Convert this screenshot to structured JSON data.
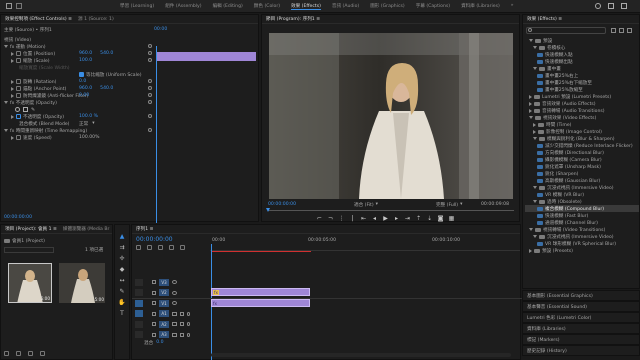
{
  "workspaces": [
    "學習 (Learning)",
    "組件 (Assembly)",
    "編輯 (Editing)",
    "顏色 (Color)",
    "效果 (Effects)",
    "音訊 (Audio)",
    "圖形 (Graphics)",
    "字幕 (Captions)",
    "資料庫 (Libraries)",
    "»"
  ],
  "active_workspace_index": 4,
  "effect_controls": {
    "tabs": [
      "效果控制項 (Effect Controls) ≡",
      "源 1 (Source: 1)"
    ],
    "source_label": "主要 (Source) • 序列1",
    "seq_label": "序列 (Sequence)",
    "ruler_time": "00:00",
    "video_label": "視訊 (Video)",
    "motion": "fx  運動 (Motion)",
    "position_label": "位置 (Position)",
    "position_x": "960.0",
    "position_y": "540.0",
    "scale_label": "縮放 (Scale)",
    "scale_value": "100.0",
    "scale_width_label": "縮放寬度 (Scale Width)",
    "uniform_scale": "等比縮放 (Uniform Scale)",
    "rotation_label": "旋轉 (Rotation)",
    "rotation_value": "0.0",
    "anchor_label": "錨點 (Anchor Point)",
    "anchor_x": "960.0",
    "anchor_y": "540.0",
    "flicker_label": "防閃爍濾鏡 (Anti-flicker Filter)",
    "flicker_value": "0.00",
    "opacity": "fx  不透明度 (Opacity)",
    "opacity_label": "不透明度 (Opacity)",
    "opacity_value": "100.0 %",
    "blend_label": "混合模式 (Blend Mode)",
    "blend_value": "正常",
    "time_remap": "fx  時間重新映射 (Time Remapping)",
    "speed_label": "速度 (Speed)",
    "speed_value": "100.00%",
    "time_display": "00:00:00:00"
  },
  "program": {
    "tab": "節目 (Program): 序列1 ≡",
    "timecode": "00:00:00:00",
    "fit": "適合 (Fit)",
    "full": "完整 (Full)",
    "duration": "00:00:09:08"
  },
  "effects": {
    "tab": "效果 (Effects) ≡",
    "items": [
      {
        "label": "預設",
        "indent": 1,
        "kind": "folder",
        "open": true
      },
      {
        "label": "卷積核心",
        "indent": 2,
        "kind": "folder",
        "open": true
      },
      {
        "label": "快速模糊入點",
        "indent": 3,
        "kind": "preset"
      },
      {
        "label": "快速模糊出點",
        "indent": 3,
        "kind": "preset"
      },
      {
        "label": "畫中畫",
        "indent": 2,
        "kind": "folder",
        "open": true
      },
      {
        "label": "畫中畫25%右上",
        "indent": 3,
        "kind": "preset"
      },
      {
        "label": "畫中畫25%右下縮放至",
        "indent": 3,
        "kind": "preset"
      },
      {
        "label": "畫中畫25%放縮至",
        "indent": 3,
        "kind": "preset"
      },
      {
        "label": "Lumetri 預設 (Lumetri Presets)",
        "indent": 1,
        "kind": "folder"
      },
      {
        "label": "音訊效果 (Audio Effects)",
        "indent": 1,
        "kind": "folder"
      },
      {
        "label": "音訊轉場 (Audio Transitions)",
        "indent": 1,
        "kind": "folder"
      },
      {
        "label": "視訊效果 (Video Effects)",
        "indent": 1,
        "kind": "folder",
        "open": true
      },
      {
        "label": "時間 (Time)",
        "indent": 2,
        "kind": "folder"
      },
      {
        "label": "影像控制 (Image Control)",
        "indent": 2,
        "kind": "folder"
      },
      {
        "label": "模糊與銳利化 (Blur & Sharpen)",
        "indent": 2,
        "kind": "folder",
        "open": true
      },
      {
        "label": "減少交錯閃爍 (Reduce Interlace Flicker)",
        "indent": 3,
        "kind": "effect"
      },
      {
        "label": "方向模糊 (Directional Blur)",
        "indent": 3,
        "kind": "effect"
      },
      {
        "label": "攝影機模糊 (Camera Blur)",
        "indent": 3,
        "kind": "effect"
      },
      {
        "label": "銳化遮罩 (Unsharp Mask)",
        "indent": 3,
        "kind": "effect"
      },
      {
        "label": "銳化 (Sharpen)",
        "indent": 3,
        "kind": "effect"
      },
      {
        "label": "高斯模糊 (Gaussian Blur)",
        "indent": 3,
        "kind": "effect"
      },
      {
        "label": "沉浸式視訊 (Immersive Video)",
        "indent": 2,
        "kind": "folder",
        "open": true
      },
      {
        "label": "VR 模糊 (VR Blur)",
        "indent": 3,
        "kind": "effect"
      },
      {
        "label": "過時 (Obsolete)",
        "indent": 2,
        "kind": "folder",
        "open": true
      },
      {
        "label": "複合模糊 (Compound Blur)",
        "indent": 3,
        "kind": "effect",
        "selected": true
      },
      {
        "label": "快速模糊 (Fast Blur)",
        "indent": 3,
        "kind": "effect"
      },
      {
        "label": "通道模糊 (Channel Blur)",
        "indent": 3,
        "kind": "effect"
      },
      {
        "label": "視訊轉場 (Video Transitions)",
        "indent": 1,
        "kind": "folder",
        "open": true
      },
      {
        "label": "沉浸式視訊 (Immersive Video)",
        "indent": 2,
        "kind": "folder",
        "open": true
      },
      {
        "label": "VR 球形模糊 (VR Spherical Blur)",
        "indent": 3,
        "kind": "effect"
      },
      {
        "label": "預設 (Presets)",
        "indent": 1,
        "kind": "folder"
      }
    ],
    "bottom_panels": [
      "基本圖形 (Essential Graphics)",
      "基本聲音 (Essential Sound)",
      "Lumetri 色彩 (Lumetri Color)",
      "資料庫 (Libraries)",
      "標記 (Markers)",
      "歷史記錄 (History)"
    ]
  },
  "project": {
    "tabs": [
      "項目 (Project): 會員 1 ≡",
      "媒體瀏覽器 (Media Br",
      "»"
    ],
    "folder": "會員1 (Project)",
    "count": "1 項已選",
    "clip1_duration": "5:00",
    "clip2_duration": "5:00"
  },
  "timeline": {
    "tab": "序列1 ≡",
    "timecode": "00:00:00:00",
    "ruler": [
      "00:00",
      "00:00:05:00",
      "00:00:10:00"
    ],
    "video_tracks": [
      "V3",
      "V2",
      "V1"
    ],
    "audio_tracks": [
      "A1",
      "A2",
      "A3"
    ],
    "mix_label": "混合",
    "mix_value": "0.0",
    "clip_v1": "fx",
    "clip_a1": "fx"
  },
  "colors": {
    "accent": "#3a8ee6",
    "clip_video": "#9f86d6",
    "clip_audio": "#9f86d6",
    "playhead": "#3a8ee6",
    "work_area": "#d03030"
  }
}
